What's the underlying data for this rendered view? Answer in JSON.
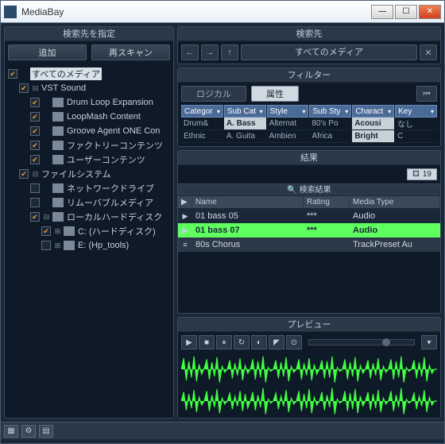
{
  "app": {
    "title": "MediaBay"
  },
  "left_panel": {
    "header": "検索先を指定",
    "btn_add": "追加",
    "btn_rescan": "再スキャン"
  },
  "tree": [
    {
      "indent": 0,
      "checked": true,
      "expand": "",
      "label": "すべてのメディア",
      "hilite": true
    },
    {
      "indent": 1,
      "checked": true,
      "expand": "⊟",
      "label": "VST Sound"
    },
    {
      "indent": 2,
      "checked": true,
      "expand": "",
      "icon": true,
      "label": "Drum Loop Expansion"
    },
    {
      "indent": 2,
      "checked": true,
      "expand": "",
      "icon": true,
      "label": "LoopMash Content"
    },
    {
      "indent": 2,
      "checked": true,
      "expand": "",
      "icon": true,
      "label": "Groove Agent ONE Con"
    },
    {
      "indent": 2,
      "checked": true,
      "expand": "",
      "icon": true,
      "label": "ファクトリーコンテンツ"
    },
    {
      "indent": 2,
      "checked": true,
      "expand": "",
      "icon": true,
      "label": "ユーザーコンテンツ"
    },
    {
      "indent": 1,
      "checked": true,
      "expand": "⊟",
      "label": "ファイルシステム"
    },
    {
      "indent": 2,
      "checked": false,
      "expand": "",
      "icon": true,
      "label": "ネットワークドライブ"
    },
    {
      "indent": 2,
      "checked": false,
      "expand": "",
      "icon": true,
      "label": "リムーバブルメディア"
    },
    {
      "indent": 2,
      "checked": true,
      "expand": "⊟",
      "icon": true,
      "label": "ローカルハードディスク"
    },
    {
      "indent": 3,
      "checked": true,
      "expand": "⊞",
      "icon": true,
      "label": "C: (ハードディスク)"
    },
    {
      "indent": 3,
      "checked": false,
      "expand": "⊞",
      "icon": true,
      "label": "E: (Hp_tools)"
    }
  ],
  "location": {
    "header": "検索先",
    "selected": "すべてのメディア"
  },
  "filters": {
    "header": "フィルター",
    "tab_logical": "ロジカル",
    "tab_attr": "属性",
    "columns": [
      {
        "head": "Categor",
        "rows": [
          {
            "t": "Drum&",
            "s": false
          },
          {
            "t": "Ethnic",
            "s": false
          }
        ]
      },
      {
        "head": "Sub Cat",
        "rows": [
          {
            "t": "A. Bass",
            "s": true
          },
          {
            "t": "A. Guita",
            "s": false
          }
        ]
      },
      {
        "head": "Style",
        "rows": [
          {
            "t": "Alternat",
            "s": false
          },
          {
            "t": "Ambien",
            "s": false
          }
        ]
      },
      {
        "head": "Sub Sty",
        "rows": [
          {
            "t": "80's Po",
            "s": false
          },
          {
            "t": "Africa",
            "s": false
          }
        ]
      },
      {
        "head": "Charact",
        "rows": [
          {
            "t": "Acousi",
            "s": true
          },
          {
            "t": "Bright",
            "s": true
          }
        ]
      },
      {
        "head": "Key",
        "rows": [
          {
            "t": "なし",
            "s": false
          },
          {
            "t": "C",
            "s": false
          }
        ]
      }
    ]
  },
  "results": {
    "header": "結果",
    "count": "19",
    "search_label": "検索結果",
    "cols": {
      "name": "Name",
      "rating": "Rating",
      "media": "Media Type"
    },
    "rows": [
      {
        "icon": "▶",
        "name": "01 bass 05",
        "rating": "***",
        "media": "Audio",
        "state": "normal"
      },
      {
        "icon": "▶",
        "name": "01 bass 07",
        "rating": "***",
        "media": "Audio",
        "state": "sel"
      },
      {
        "icon": "≡",
        "name": "80s Chorus",
        "rating": "",
        "media": "TrackPreset Au",
        "state": "alt"
      }
    ]
  },
  "preview": {
    "header": "プレビュー",
    "volume_pct": 70
  }
}
